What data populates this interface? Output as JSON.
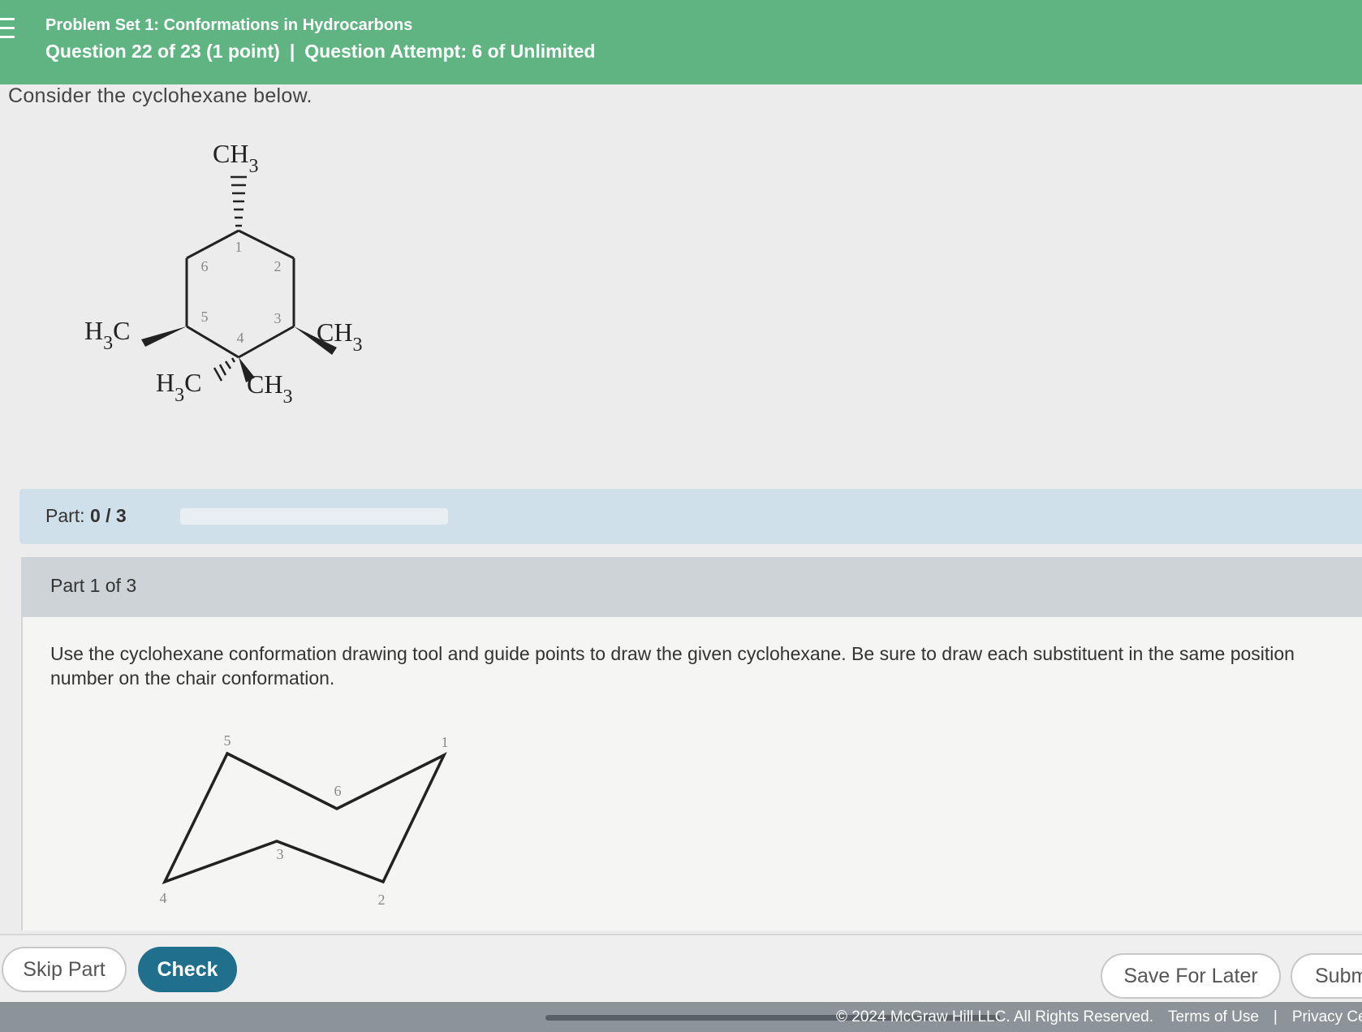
{
  "header": {
    "title": "Problem Set 1: Conformations in Hydrocarbons",
    "question": "Question 22 of 23 (1 point)",
    "separator": "|",
    "attempt": "Question Attempt: 6 of Unlimited"
  },
  "prompt": "Consider the cyclohexane below.",
  "structure": {
    "ring_numbers": [
      "1",
      "2",
      "3",
      "4",
      "5",
      "6"
    ],
    "substituents": {
      "c1": {
        "text": "CH",
        "sub": "3",
        "bond": "hash"
      },
      "c3": {
        "text": "CH",
        "sub": "3",
        "bond": "wedge"
      },
      "c4_hash": {
        "pre": "H",
        "sub": "3",
        "text": "C",
        "bond": "hash"
      },
      "c4_wedge": {
        "text": "CH",
        "sub": "3",
        "bond": "wedge"
      },
      "c5": {
        "pre": "H",
        "sub": "3",
        "text": "C",
        "bond": "wedge"
      }
    }
  },
  "part_progress": {
    "label": "Part:",
    "value": "0 / 3",
    "fraction": 0
  },
  "part": {
    "title": "Part 1 of 3",
    "instructions": "Use the cyclohexane conformation drawing tool and guide points to draw the given cyclohexane. Be sure to draw each substituent in the same position number on the chair conformation.",
    "chair_numbers": [
      "1",
      "2",
      "3",
      "4",
      "5",
      "6"
    ]
  },
  "buttons": {
    "skip": "Skip Part",
    "check": "Check",
    "save": "Save For Later",
    "submit": "Subm"
  },
  "footer": {
    "copyright": "© 2024 McGraw Hill LLC. All Rights Reserved.",
    "terms": "Terms of Use",
    "separator": "|",
    "privacy": "Privacy Ce"
  },
  "colors": {
    "header": "#5fb482",
    "check_button": "#1f6f8d",
    "progress_bar": "#cfe0ea"
  }
}
